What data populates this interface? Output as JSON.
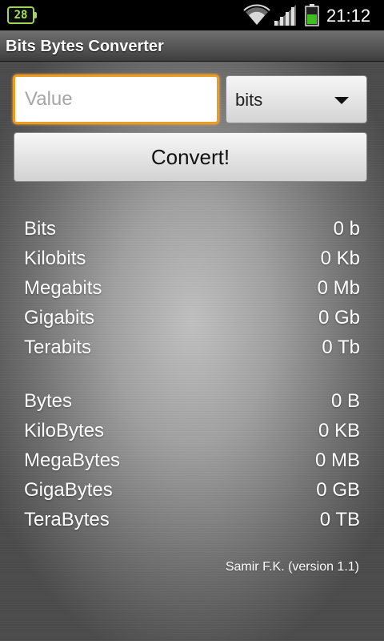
{
  "status_bar": {
    "notification_badge": "28",
    "time": "21:12",
    "icons": [
      "wifi-icon",
      "signal-icon",
      "battery-icon"
    ]
  },
  "app": {
    "title": "Bits Bytes Converter"
  },
  "form": {
    "value_placeholder": "Value",
    "value_current": "",
    "unit_selected": "bits",
    "convert_label": "Convert!"
  },
  "bits": [
    {
      "label": "Bits",
      "value": "0 b"
    },
    {
      "label": "Kilobits",
      "value": "0 Kb"
    },
    {
      "label": "Megabits",
      "value": "0 Mb"
    },
    {
      "label": "Gigabits",
      "value": "0 Gb"
    },
    {
      "label": "Terabits",
      "value": "0 Tb"
    }
  ],
  "bytes": [
    {
      "label": "Bytes",
      "value": "0 B"
    },
    {
      "label": "KiloBytes",
      "value": "0 KB"
    },
    {
      "label": "MegaBytes",
      "value": "0 MB"
    },
    {
      "label": "GigaBytes",
      "value": "0 GB"
    },
    {
      "label": "TeraBytes",
      "value": "0 TB"
    }
  ],
  "footer": "Samir F.K. (version 1.1)",
  "colors": {
    "accent_focus": "#f29a1c",
    "battery_green": "#3fbf1f"
  }
}
